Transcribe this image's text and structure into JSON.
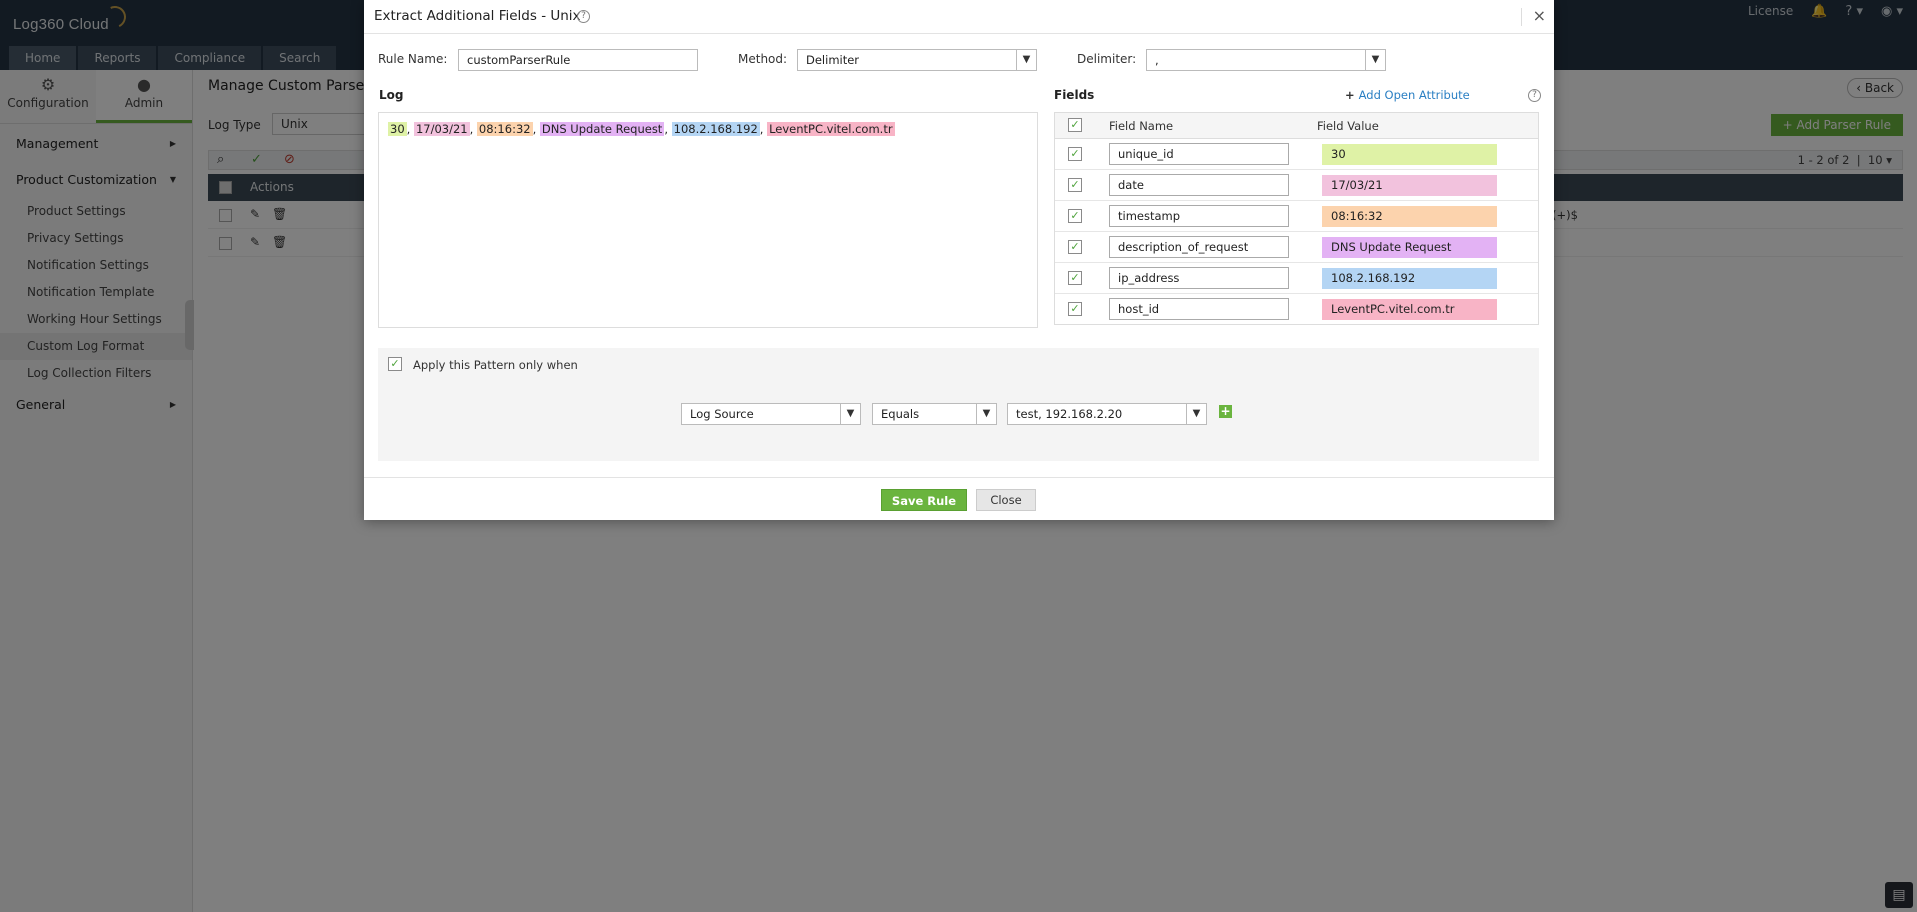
{
  "app": {
    "logo": "Log360 Cloud"
  },
  "header": {
    "license_label": "License",
    "help_label": "?",
    "nav_tabs": [
      "Home",
      "Reports",
      "Compliance",
      "Search"
    ]
  },
  "sidebar": {
    "tabs": [
      {
        "label": "Configuration"
      },
      {
        "label": "Admin"
      }
    ],
    "groups": [
      {
        "label": "Management"
      },
      {
        "label": "Product Customization"
      },
      {
        "label": "General"
      }
    ],
    "items": [
      "Product Settings",
      "Privacy Settings",
      "Notification Settings",
      "Notification Template",
      "Working Hour Settings",
      "Custom Log Format",
      "Log Collection Filters"
    ]
  },
  "content": {
    "page_title": "Manage Custom Parser R",
    "back_label": "Back",
    "log_type_label": "Log Type",
    "log_type_value": "Unix",
    "add_parser_label": "Add Parser Rule",
    "pager_text": "1 - 2 of 2",
    "page_size": "10",
    "table_actions_header": "Actions",
    "row_tail_text": "(+)$"
  },
  "modal": {
    "title": "Extract Additional Fields - Unix",
    "close_glyph": "×",
    "rule_name_label": "Rule Name:",
    "rule_name_value": "customParserRule",
    "method_label": "Method:",
    "method_value": "Delimiter",
    "delimiter_label": "Delimiter:",
    "delimiter_value": ",",
    "log_label": "Log",
    "log_tokens": [
      {
        "text": "30",
        "color": "#dff2a6"
      },
      {
        "text": "17/03/21",
        "color": "#f2c2dd"
      },
      {
        "text": "08:16:32",
        "color": "#fcd3ad"
      },
      {
        "text": "DNS Update Request",
        "color": "#e3b2f4"
      },
      {
        "text": "108.2.168.192",
        "color": "#b4d5f4"
      },
      {
        "text": "LeventPC.vitel.com.tr",
        "color": "#f8b4c6"
      }
    ],
    "log_separator": ", ",
    "fields_label": "Fields",
    "add_open_attribute_label": "Add Open Attribute",
    "field_name_header": "Field Name",
    "field_value_header": "Field Value",
    "fields": [
      {
        "name": "unique_id",
        "value": "30",
        "color": "#dff2a6"
      },
      {
        "name": "date",
        "value": "17/03/21",
        "color": "#f2c2dd"
      },
      {
        "name": "timestamp",
        "value": "08:16:32",
        "color": "#fcd3ad"
      },
      {
        "name": "description_of_request",
        "value": "DNS Update Request",
        "color": "#e3b2f4"
      },
      {
        "name": "ip_address",
        "value": "108.2.168.192",
        "color": "#b4d5f4"
      },
      {
        "name": "host_id",
        "value": "LeventPC.vitel.com.tr",
        "color": "#f8b4c6"
      }
    ],
    "apply_pattern_label": "Apply this Pattern only when",
    "condition": {
      "field": "Log Source",
      "operator": "Equals",
      "value": "test, 192.168.2.20"
    },
    "save_label": "Save Rule",
    "close_label": "Close"
  }
}
